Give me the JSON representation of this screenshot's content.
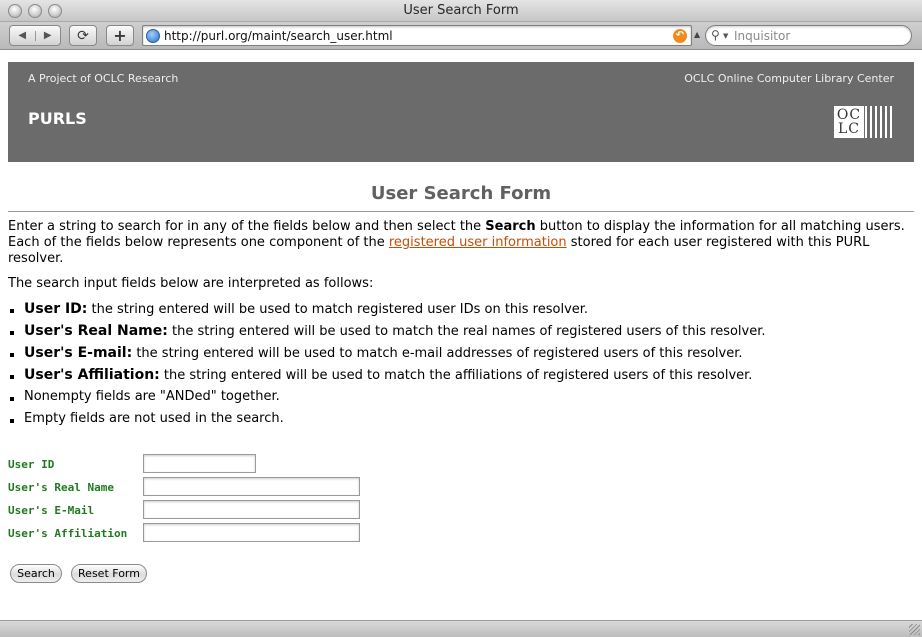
{
  "window": {
    "title": "User Search Form"
  },
  "toolbar": {
    "back_icon": "◀",
    "forward_icon": "▶",
    "reload_icon": "⟳",
    "add_bookmark_icon": "+",
    "url": "http://purl.org/maint/search_user.html",
    "search_placeholder": "Inquisitor"
  },
  "banner": {
    "tagline": "A Project of OCLC Research",
    "org_name": "OCLC Online Computer Library Center",
    "site_name": "PURLS",
    "logo_text": "OCLC"
  },
  "page": {
    "title": "User Search Form",
    "intro_part1": "Enter a string to search for in any of the fields below and then select the ",
    "intro_bold": "Search",
    "intro_part2": " button to display the information for all matching users. Each of the fields below represents one component of the ",
    "intro_link": "registered user information",
    "intro_part3": " stored for each user registered with this PURL resolver.",
    "lead": "The search input fields below are interpreted as follows:",
    "rules": [
      {
        "term": "User ID:",
        "text": " the string entered will be used to match registered user IDs on this resolver."
      },
      {
        "term": "User's Real Name:",
        "text": " the string entered will be used to match the real names of registered users of this resolver."
      },
      {
        "term": "User's E-mail:",
        "text": " the string entered will be used to match e-mail addresses of registered users of this resolver."
      },
      {
        "term": "User's Affiliation:",
        "text": " the string entered will be used to match the affiliations of registered users of this resolver."
      },
      {
        "term": "",
        "text": "Nonempty fields are \"ANDed\" together."
      },
      {
        "term": "",
        "text": "Empty fields are not used in the search."
      }
    ]
  },
  "form": {
    "user_id_label": "User ID",
    "user_id_value": "",
    "real_name_label": "User's Real Name",
    "real_name_value": "",
    "email_label": "User's E-Mail",
    "email_value": "",
    "affiliation_label": "User's Affiliation",
    "affiliation_value": "",
    "search_button": "Search",
    "reset_button": "Reset Form"
  },
  "colors": {
    "banner": "#6b6b6b",
    "link": "#c24e06",
    "form_label": "#1f7a1f",
    "title": "#616161"
  }
}
